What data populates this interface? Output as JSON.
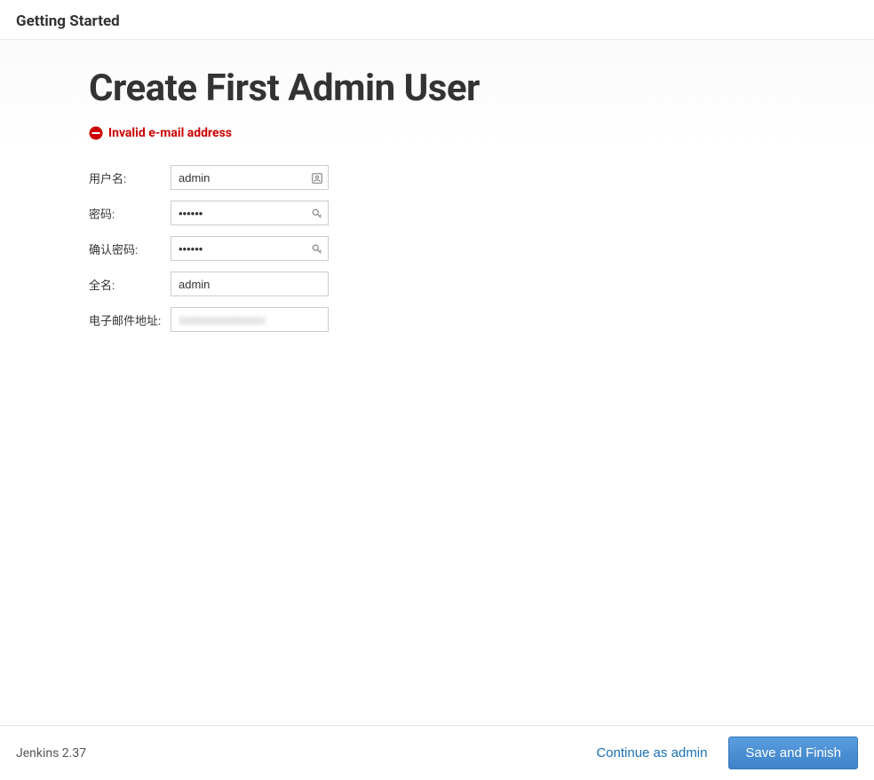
{
  "header": {
    "title": "Getting Started"
  },
  "main": {
    "title": "Create First Admin User",
    "error": "Invalid e-mail address",
    "fields": {
      "username": {
        "label": "用户名:",
        "value": "admin"
      },
      "password": {
        "label": "密码:",
        "value": "••••••"
      },
      "confirm_password": {
        "label": "确认密码:",
        "value": "••••••"
      },
      "fullname": {
        "label": "全名:",
        "value": "admin"
      },
      "email": {
        "label": "电子邮件地址:",
        "value": "xxxxxxxxxxxxxxx"
      }
    }
  },
  "footer": {
    "version": "Jenkins 2.37",
    "continue_label": "Continue as admin",
    "save_label": "Save and Finish"
  }
}
